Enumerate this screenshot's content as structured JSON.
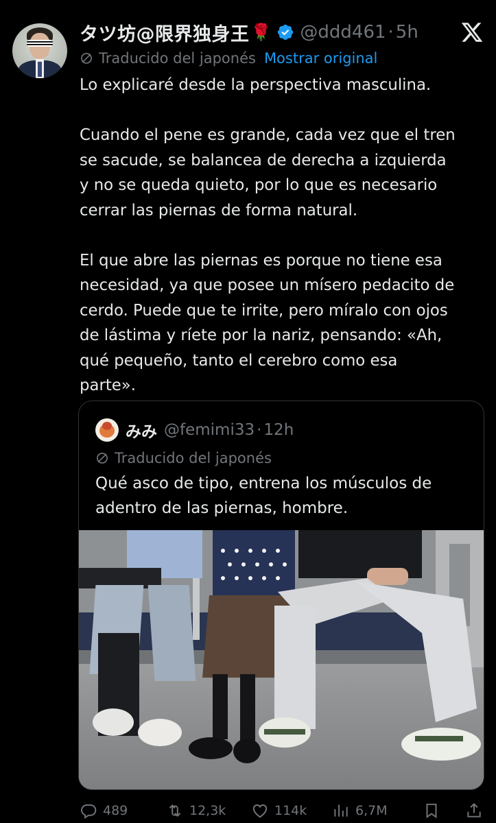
{
  "tweet": {
    "author_name": "タツ坊@限界独身王",
    "author_emoji": "🌹",
    "handle": "@ddd461",
    "separator": "·",
    "time": "5h",
    "translated_label": "Traducido del japonés",
    "show_original_label": "Mostrar original",
    "lines": [
      "Lo explicaré desde la perspectiva masculina.",
      "",
      "Cuando el pene es grande, cada vez que el tren",
      "se sacude, se balancea de derecha a izquierda",
      "y no se queda quieto, por lo que es necesario",
      "cerrar las piernas de forma natural.",
      "",
      "El que abre las piernas es porque no tiene esa",
      "necesidad, ya que posee un mísero pedacito de",
      "cerdo. Puede que te irrite, pero míralo con ojos",
      "de lástima y ríete por la nariz, pensando: «Ah,",
      "qué pequeño, tanto el cerebro como esa",
      "parte»."
    ]
  },
  "quote": {
    "author_name": "みみ",
    "handle": "@femimi33",
    "separator": "·",
    "time": "12h",
    "translated_label": "Traducido del japonés",
    "lines": [
      "Qué asco de tipo, entrena los músculos de",
      "adentro de las piernas, hombre."
    ]
  },
  "actions": {
    "replies": "489",
    "retweets": "12,3k",
    "likes": "114k",
    "views": "6,7M"
  },
  "colors": {
    "background": "#000000",
    "text": "#e7e9ea",
    "muted": "#71767b",
    "accent": "#1d9bf0",
    "border": "#2f3336"
  },
  "icons": [
    "verified-badge-icon",
    "x-logo-icon",
    "translate-slash-icon",
    "reply-icon",
    "retweet-icon",
    "like-icon",
    "views-icon",
    "bookmark-icon",
    "share-icon"
  ]
}
